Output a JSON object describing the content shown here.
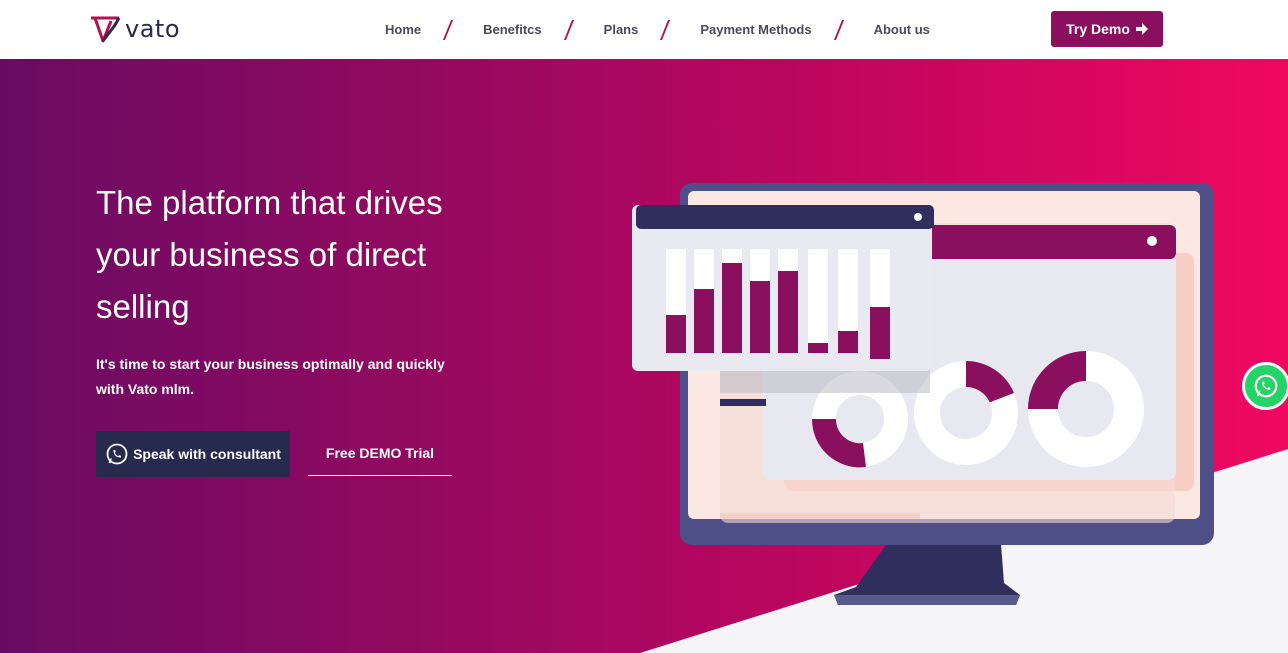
{
  "brand": {
    "name": "vato",
    "primary": "#8a0f5f",
    "dark": "#272a4f",
    "accent": "#b0124f"
  },
  "nav": {
    "items": [
      {
        "label": "Home"
      },
      {
        "label": "Benefitcs"
      },
      {
        "label": "Plans"
      },
      {
        "label": "Payment Methods"
      },
      {
        "label": "About us"
      }
    ],
    "cta_label": "Try Demo",
    "cta_icon": "arrow-right-icon"
  },
  "hero": {
    "title_lines": [
      "The platform that drives",
      "your business of direct",
      "selling"
    ],
    "subtitle_lines": [
      "It's time to start your business optimally and quickly",
      "with Vato mlm."
    ],
    "consult_label": "Speak with consultant",
    "consult_icon": "whatsapp-icon",
    "demo_label": "Free DEMO Trial"
  },
  "floating": {
    "icon": "whatsapp-icon",
    "color": "#25d366"
  }
}
